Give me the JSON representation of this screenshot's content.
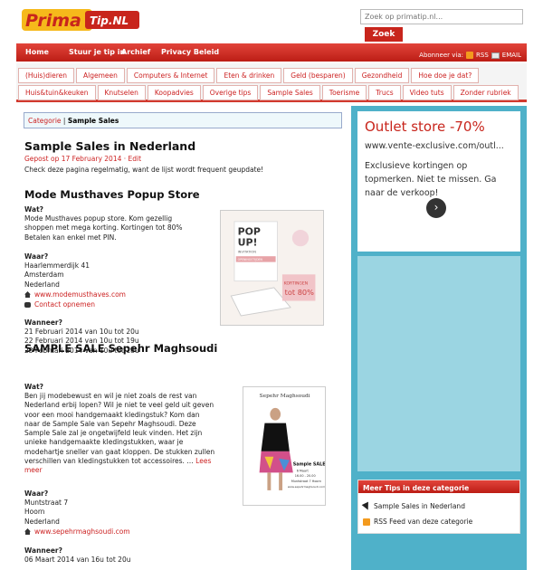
{
  "logo": {
    "text1": "Prima",
    "text2": "Tip.NL"
  },
  "search": {
    "placeholder": "Zoek op primatip.nl...",
    "button": "Zoek"
  },
  "nav": {
    "items": [
      "Home",
      "Stuur je tip in",
      "Archief",
      "Privacy Beleid"
    ],
    "subscribe": "Abonneer via:",
    "rss": "RSS",
    "email": "EMAIL"
  },
  "categories": {
    "row1": [
      "(Huis)dieren",
      "Algemeen",
      "Computers & Internet",
      "Eten & drinken",
      "Geld (besparen)",
      "Gezondheid",
      "Hoe doe je dat?"
    ],
    "row2": [
      "Huis&tuin&keuken",
      "Knutselen",
      "Koopadvies",
      "Overige tips",
      "Sample Sales",
      "Toerisme",
      "Trucs",
      "Video tuts",
      "Zonder rubriek"
    ]
  },
  "breadcrumb": {
    "label": "Categorie",
    "sep": "|",
    "current": "Sample Sales"
  },
  "post": {
    "title": "Sample Sales in Nederland",
    "meta": "Gepost op 17 February 2014 · Edit",
    "intro": "Check deze pagina regelmatig, want de lijst wordt frequent geupdate!"
  },
  "store1": {
    "title": "Mode Musthaves Popup Store",
    "wat_label": "Wat?",
    "wat": [
      "Mode Musthaves popup store. Kom gezellig",
      "shoppen met mega korting. Kortingen tot 80%",
      "Betalen kan enkel met PIN."
    ],
    "waar_label": "Waar?",
    "waar": [
      "Haarlemmerdijk 41",
      "Amsterdam",
      "Nederland"
    ],
    "site": "www.modemusthaves.com",
    "contact": "Contact opnemen",
    "wanneer_label": "Wanneer?",
    "wanneer": [
      "21 Februari 2014 van 10u tot 20u",
      "22 Februari 2014 van 10u tot 19u",
      "23 Februari 2014 van 10u tot 18u"
    ],
    "image": {
      "line1": "POP",
      "line2": "UP!",
      "invite": "INVITATION",
      "open": "OPENINGSTIJDEN",
      "korting": "KORTINGEN",
      "tot": "tot 80%"
    }
  },
  "store2": {
    "title": "SAMPLE SALE Sepehr Maghsoudi",
    "wat_label": "Wat?",
    "wat": [
      "Ben jij modebewust en wil je niet zoals de rest van",
      "Nederland erbij lopen? Wil je niet te veel geld uit geven",
      "voor een mooi handgemaakt kledingstuk? Kom dan",
      "naar de Sample Sale van Sepehr Maghsoudi. Deze",
      "Sample Sale zal je ongetwijfeld leuk vinden. Het zijn",
      "unieke handgemaakte kledingstukken, waar je",
      "modehartje sneller van gaat kloppen. De stukken zullen",
      "verschillen van kledingstukken tot accessoires. …"
    ],
    "lees": "Lees",
    "meer": "meer",
    "waar_label": "Waar?",
    "waar": [
      "Muntstraat 7",
      "Hoorn",
      "Nederland"
    ],
    "site": "www.sepehrmaghsoudi.com",
    "wanneer_label": "Wanneer?",
    "wanneer": [
      "06 Maart 2014 van 16u tot 20u"
    ],
    "image": {
      "name": "Sepehr Maghsoudi",
      "sale": "Sample SALE",
      "date": "6 Maart",
      "time": "16.00 - 20.00",
      "addr": "Muntstraat 7 Hoorn",
      "url": "www.sepehrmaghsoudi.com"
    }
  },
  "ad": {
    "title": "Outlet store -70%",
    "url": "www.vente-exclusive.com/outl...",
    "desc": "Exclusieve kortingen op topmerken. Niet te missen. Ga naar de verkoop!"
  },
  "tips": {
    "header": "Meer Tips in deze categorie",
    "item1": "Sample Sales in Nederland",
    "item2": "RSS Feed van deze categorie"
  }
}
